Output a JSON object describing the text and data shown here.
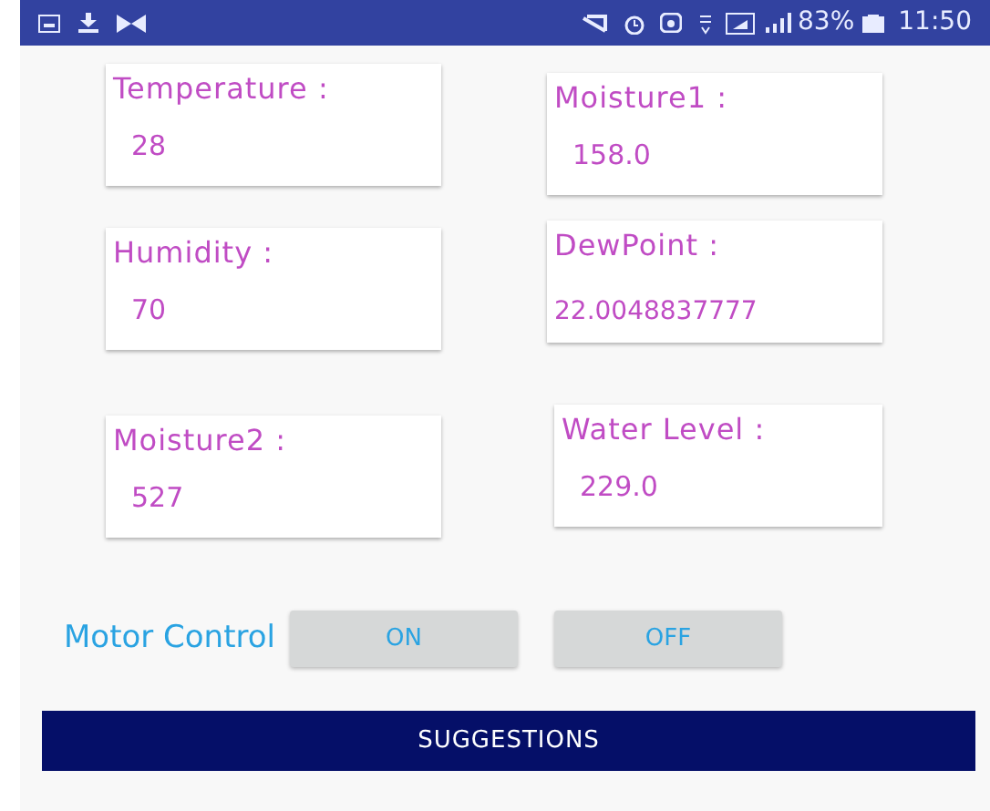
{
  "status_bar": {
    "battery": "83%",
    "time": "11:50"
  },
  "sensors": [
    {
      "label": "Temperature :",
      "value": "28"
    },
    {
      "label": "Moisture1 :",
      "value": "158.0"
    },
    {
      "label": "Humidity :",
      "value": "70"
    },
    {
      "label": "DewPoint :",
      "value": "22.0048837777"
    },
    {
      "label": "Moisture2 :",
      "value": "527"
    },
    {
      "label": "Water Level :",
      "value": "229.0"
    }
  ],
  "motor_control": {
    "label": "Motor Control",
    "buttons": [
      "ON",
      "OFF"
    ]
  },
  "suggestions_button": "SUGGESTIONS"
}
